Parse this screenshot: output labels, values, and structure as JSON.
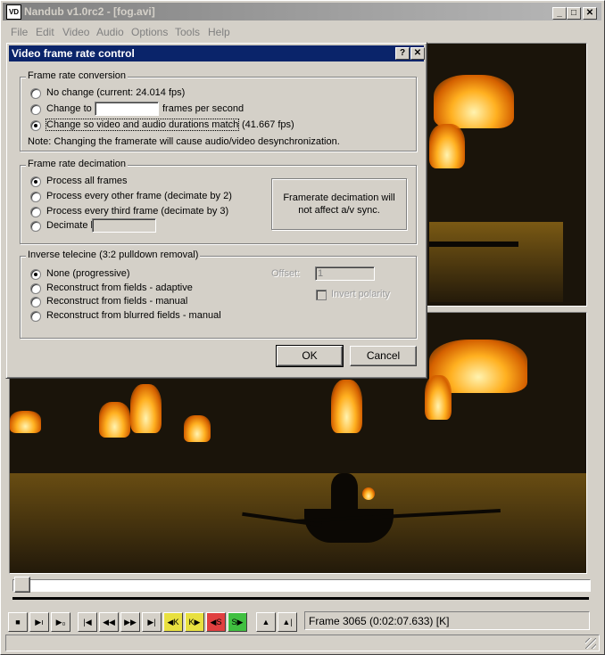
{
  "window": {
    "title": "Nandub v1.0rc2 - [fog.avi]",
    "icon": "nandub-app-icon",
    "buttons": [
      "minimize",
      "maximize",
      "close"
    ]
  },
  "menu": [
    {
      "label": "File"
    },
    {
      "label": "Edit"
    },
    {
      "label": "Video"
    },
    {
      "label": "Audio"
    },
    {
      "label": "Options"
    },
    {
      "label": "Tools"
    },
    {
      "label": "Help"
    }
  ],
  "dialog": {
    "title": "Video frame rate control",
    "help_button": "?",
    "close_button": "✕",
    "conversion": {
      "label": "Frame rate conversion",
      "no_change": "No change (current: 24.014 fps)",
      "change_to": "Change to",
      "change_to_value": "",
      "fps_suffix": "frames per second",
      "match": "Change so video and audio durations match",
      "match_fps": "(41.667 fps)",
      "selected": "match",
      "note": "Note: Changing the framerate will cause audio/video desynchronization."
    },
    "decimation": {
      "label": "Frame rate decimation",
      "all": "Process all frames",
      "other": "Process every other frame (decimate by 2)",
      "third": "Process every third frame (decimate by 3)",
      "by": "Decimate by",
      "by_value": "",
      "selected": "all",
      "info": "Framerate decimation will not affect a/v sync."
    },
    "telecine": {
      "label": "Inverse telecine (3:2 pulldown removal)",
      "none": "None (progressive)",
      "adaptive": "Reconstruct from fields - adaptive",
      "manual": "Reconstruct from fields - manual",
      "blurred": "Reconstruct from blurred fields - manual",
      "selected": "none",
      "offset_label": "Offset:",
      "offset_value": "1",
      "invert_polarity": "Invert polarity"
    },
    "ok": "OK",
    "cancel": "Cancel"
  },
  "status": {
    "frame": "Frame 3065 (0:02:07.633) [K]"
  },
  "toolbar": {
    "icons": [
      "stop-icon",
      "play-input-icon",
      "play-output-icon",
      "go-start-icon",
      "step-back-icon",
      "step-forward-icon",
      "go-end-icon",
      "prev-keyframe-icon",
      "next-keyframe-icon",
      "prev-scene-icon",
      "next-scene-icon",
      "mark-in-icon",
      "mark-out-icon"
    ]
  }
}
